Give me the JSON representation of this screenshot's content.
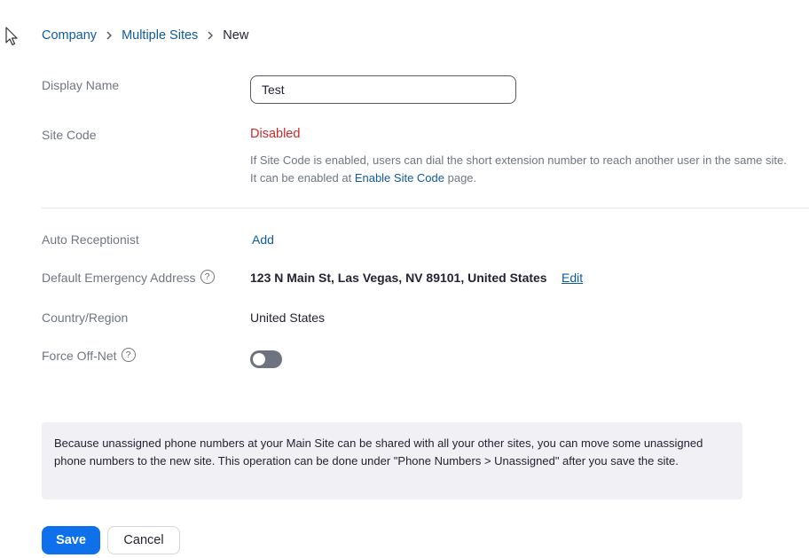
{
  "breadcrumb": {
    "items": [
      {
        "label": "Company"
      },
      {
        "label": "Multiple Sites"
      }
    ],
    "current": "New"
  },
  "form": {
    "display_name": {
      "label": "Display Name",
      "value": "Test"
    },
    "site_code": {
      "label": "Site Code",
      "status": "Disabled",
      "help_before": "If Site Code is enabled, users can dial the short extension number to reach another user in the same site. It can be enabled at ",
      "help_link": "Enable Site Code",
      "help_after": " page."
    },
    "auto_receptionist": {
      "label": "Auto Receptionist",
      "action": "Add"
    },
    "emergency_address": {
      "label": "Default Emergency Address",
      "value": "123 N Main St, Las Vegas, NV 89101, United States",
      "action": "Edit"
    },
    "country_region": {
      "label": "Country/Region",
      "value": "United States"
    },
    "force_off_net": {
      "label": "Force Off-Net",
      "enabled": false
    },
    "help_glyph": "?"
  },
  "info_box": {
    "text": "Because unassigned phone numbers at your Main Site can be shared with all your other sites, you can move some unassigned phone numbers to the new site. This operation can be done under \"Phone Numbers > Unassigned\" after you save the site."
  },
  "buttons": {
    "save": "Save",
    "cancel": "Cancel"
  },
  "colors": {
    "link": "#0e5a9e",
    "primary": "#0e71eb",
    "danger": "#d4262c",
    "toggle_off": "#6e7380",
    "info_bg": "#f1f1f5"
  },
  "icons": {
    "cursor": "mouse-pointer-icon",
    "breadcrumb_separator": "chevron-right-icon",
    "help": "question-circle-icon"
  }
}
